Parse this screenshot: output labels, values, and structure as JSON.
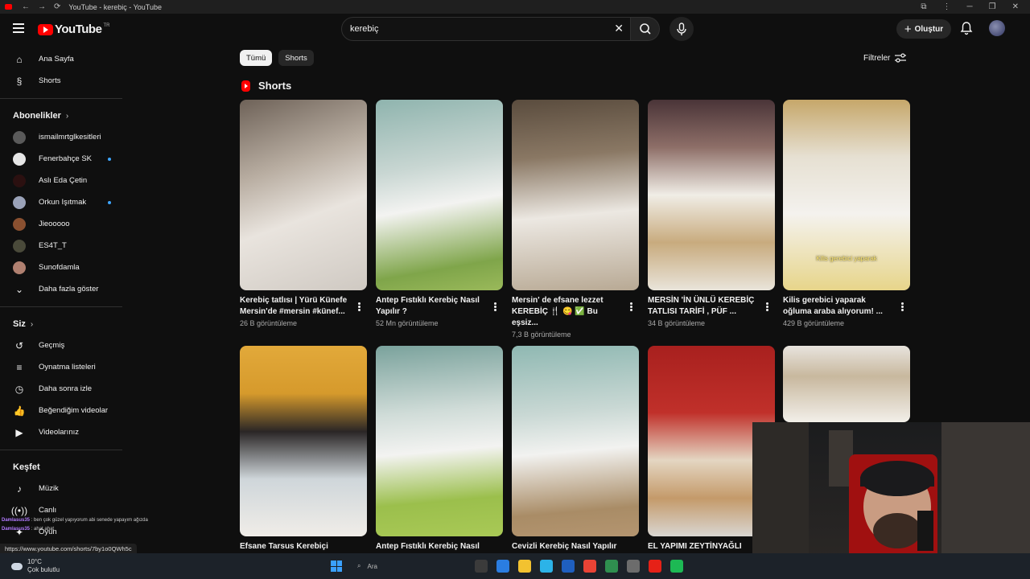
{
  "browser": {
    "tab_title": "YouTube - kerebiç - YouTube",
    "back": "←",
    "forward": "→",
    "reload": "⟳",
    "menu_icons": [
      "⧉",
      "⋮",
      "─",
      "❐",
      "✕"
    ]
  },
  "masthead": {
    "logo_text": "YouTube",
    "region_code": "TR",
    "search_value": "kerebiç",
    "create_label": "Oluştur"
  },
  "sidebar": {
    "main": [
      {
        "label": "Ana Sayfa",
        "icon": "⌂"
      },
      {
        "label": "Shorts",
        "icon": "§"
      }
    ],
    "subscriptions_title": "Abonelikler",
    "subscriptions": [
      {
        "label": "ismailmrtglkesitleri",
        "color": "#5a5a5a",
        "dot": false
      },
      {
        "label": "Fenerbahçe SK",
        "color": "#e6e6e6",
        "dot": true
      },
      {
        "label": "Aslı Eda Çetin",
        "color": "#2b1010",
        "dot": false
      },
      {
        "label": "Orkun Işıtmak",
        "color": "#9aa2b8",
        "dot": true
      },
      {
        "label": "Jieooooo",
        "color": "#8a5030",
        "dot": false
      },
      {
        "label": "ES4T_T",
        "color": "#4a4a3a",
        "dot": false
      },
      {
        "label": "Sunofdamla",
        "color": "#b08070",
        "dot": false
      }
    ],
    "show_more": "Daha fazla göster",
    "you_title": "Siz",
    "you_items": [
      {
        "label": "Geçmiş",
        "icon": "↺"
      },
      {
        "label": "Oynatma listeleri",
        "icon": "≡"
      },
      {
        "label": "Daha sonra izle",
        "icon": "◷"
      },
      {
        "label": "Beğendiğim videolar",
        "icon": "👍"
      },
      {
        "label": "Videolarınız",
        "icon": "▶"
      }
    ],
    "explore_title": "Keşfet",
    "explore_items": [
      {
        "label": "Müzik",
        "icon": "♪"
      },
      {
        "label": "Canlı",
        "icon": "((•))"
      },
      {
        "label": "Oyun",
        "icon": "✦"
      }
    ]
  },
  "chips": [
    "Tümü",
    "Shorts"
  ],
  "filters_label": "Filtreler",
  "shorts_section_title": "Shorts",
  "shorts": [
    {
      "title": "Kerebiç tatlısı | Yürü Künefe Mersin'de #mersin #künef...",
      "views": "26 B görüntüleme",
      "bg": "linear-gradient(160deg,#6e6258 0%,#b9aea2 35%,#e9e4de 60%,#cfc9c2 100%)",
      "caption": ""
    },
    {
      "title": "Antep Fıstıklı Kerebiç Nasıl Yapılır ?",
      "views": "52 Mn görüntüleme",
      "bg": "linear-gradient(170deg,#8fb4ae 0%,#c8d6d2 35%,#f3f3f1 55%,#7fa54a 85%,#9ab95a 100%)",
      "caption": ""
    },
    {
      "title": "Mersin' de efsane lezzet KEREBİÇ 🍴 😋 ✅ Bu eşsiz...",
      "views": "7,3 B görüntüleme",
      "bg": "linear-gradient(175deg,#5a4c3e 0%,#8a7864 30%,#ece8e2 60%,#b8a994 100%)",
      "caption": ""
    },
    {
      "title": "MERSİN 'İN ÜNLÜ KEREBİÇ TATLISI TARİFİ , PÜF ...",
      "views": "34 B görüntüleme",
      "bg": "linear-gradient(180deg,#4a3438 0%,#8e6f68 25%,#f0ede6 50%,#c8ab7e 75%,#e9e4da 100%)",
      "caption": ""
    },
    {
      "title": "Kilis gerebici yaparak oğluma araba alıyorum! ...",
      "views": "429 B görüntüleme",
      "bg": "linear-gradient(180deg,#c6a76a 0%,#e6e0d2 30%,#f4f2ee 60%,#e7d58a 100%)",
      "caption": "Kilis gerebici yaparak"
    },
    {
      "title": "Efsane Tarsus Kerebiçi",
      "views": "",
      "bg": "linear-gradient(180deg,#e2a93a 0%,#d69a2c 25%,#2a2626 45%,#cfd6da 70%,#f0ede8 100%)",
      "caption": ""
    },
    {
      "title": "Antep Fıstıklı Kerebiç Nasıl",
      "views": "",
      "bg": "linear-gradient(175deg,#7aa29c 0%,#d0dcd8 35%,#f3f3f1 55%,#9bbf4c 80%,#a9c956 100%)",
      "caption": ""
    },
    {
      "title": "Cevizli Kerebiç Nasıl Yapılır",
      "views": "",
      "bg": "linear-gradient(175deg,#8fb8b2 0%,#c9d8d4 35%,#f2f2f0 55%,#a98c66 85%,#b49570 100%)",
      "caption": ""
    },
    {
      "title": "EL YAPIMI ZEYTİNYAĞLI",
      "views": "",
      "bg": "linear-gradient(180deg,#a8201e 0%,#c0302a 35%,#e4d6c2 60%,#c49a6a 80%,#d9d6d2 100%)",
      "caption": ""
    },
    {
      "title": "",
      "views": "",
      "bg": "linear-gradient(180deg,#e8e4de 0%,#c8b89e 40%,#f2efe9 100%)",
      "caption": ""
    }
  ],
  "chat": [
    {
      "user": "Damlasus35",
      "text": "ben çok güzel yapıyorum abi senede yapayım ağızda"
    },
    {
      "user": "Damlasus35",
      "text": "ahat ahat"
    }
  ],
  "status_url": "https://www.youtube.com/shorts/7by1o0QWh5c",
  "taskbar": {
    "temp": "10°C",
    "weather": "Çok bulutlu",
    "search_placeholder": "Ara",
    "app_colors": [
      "#3b3b3b",
      "#2a7de1",
      "#f2c230",
      "#2cb3e8",
      "#1f5fbf",
      "#ea4335",
      "#2f8f4f",
      "#6c6c6c",
      "#e62117",
      "#1db954"
    ]
  }
}
